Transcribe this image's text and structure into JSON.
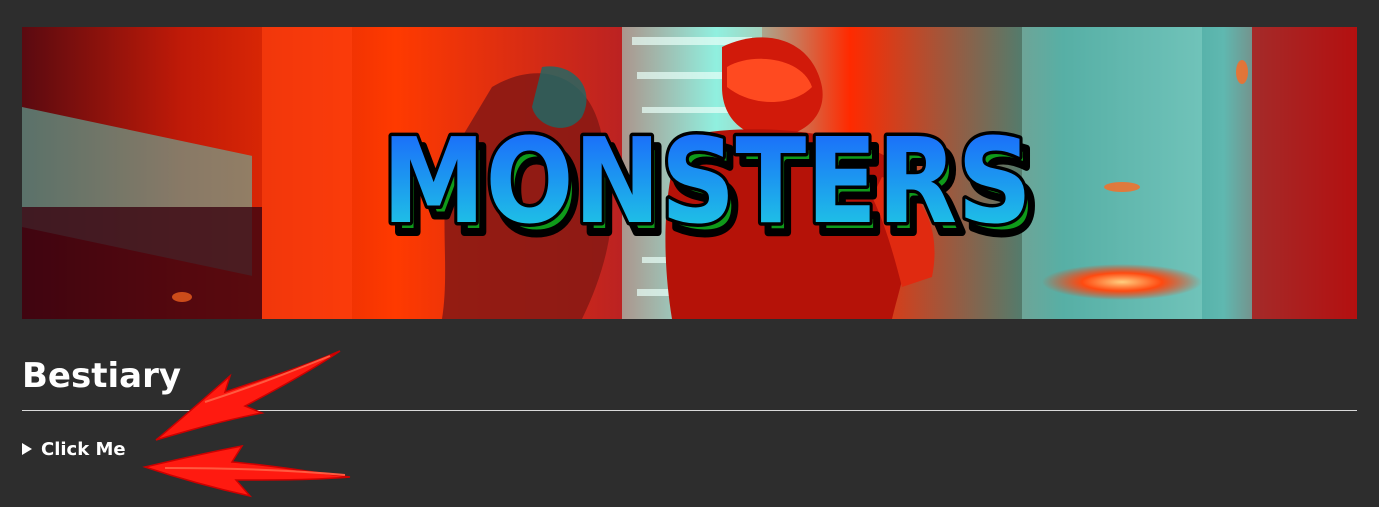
{
  "banner": {
    "title": "MONSTERS",
    "colors": {
      "red": "#ff2a00",
      "teal": "#3fd0bf",
      "title_fill_top": "#1a5cff",
      "title_fill_bottom": "#1fd6e0",
      "title_shadow": "#0f9a1a"
    }
  },
  "section": {
    "heading": "Bestiary"
  },
  "details": {
    "summary_label": "Click Me",
    "expanded": false
  },
  "annotations": {
    "arrow_color": "#ff1a10",
    "arrow_count": 2
  }
}
